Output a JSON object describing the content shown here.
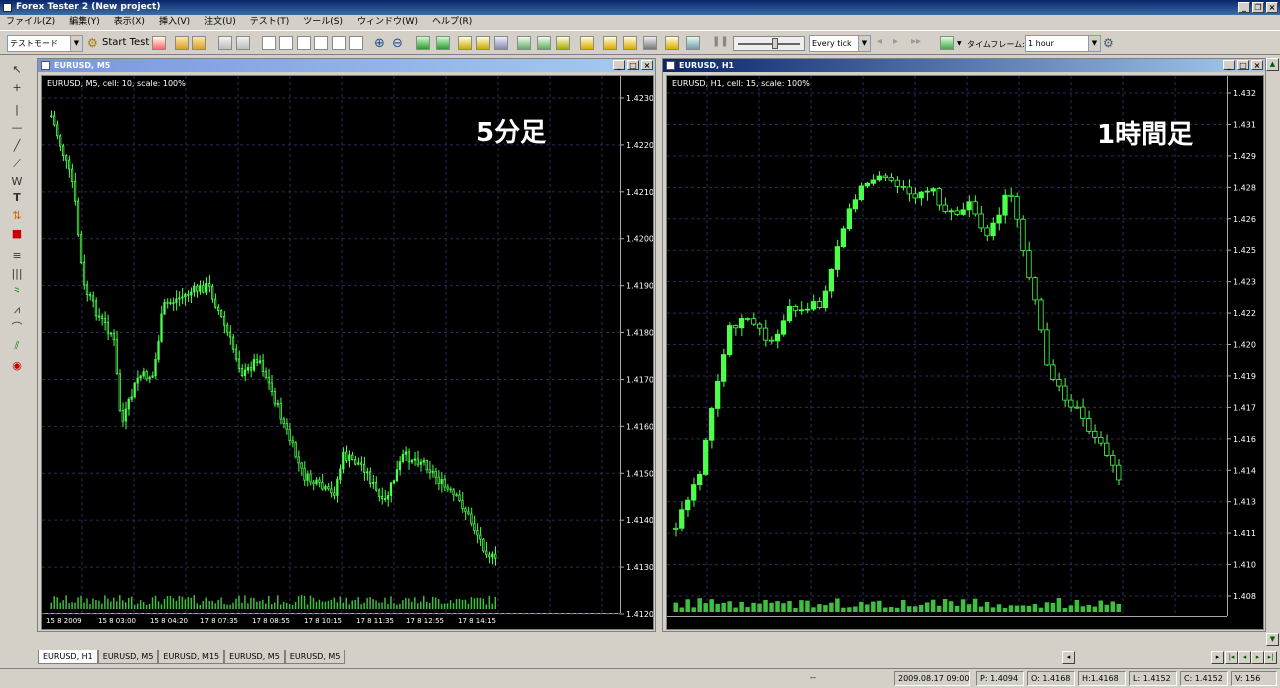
{
  "window": {
    "title": "Forex Tester 2  (New project)"
  },
  "menu": [
    "ファイル(Z)",
    "編集(Y)",
    "表示(X)",
    "挿入(V)",
    "注文(U)",
    "テスト(T)",
    "ツール(S)",
    "ウィンドウ(W)",
    "ヘルプ(R)"
  ],
  "toolbar": {
    "mode": "テストモード",
    "start_test": "Start Test",
    "tick_mode": "Every tick",
    "timeframe_label": "タイムフレーム:",
    "timeframe_value": "1 hour"
  },
  "charts": {
    "left": {
      "title": "EURUSD, M5",
      "info": "EURUSD, M5, cell: 10, scale: 100%",
      "annotation": "5分足",
      "price_labels": [
        "1.4230",
        "1.4220",
        "1.4210",
        "1.4200",
        "1.4190",
        "1.4180",
        "1.4170",
        "1.4160",
        "1.4150",
        "1.4140",
        "1.4130",
        "1.4120"
      ],
      "time_labels": [
        "15 8 2009",
        "15 8 03:00",
        "15 8 04:20",
        "17 8 07:35",
        "17 8 08:55",
        "17 8 10:15",
        "17 8 11:35",
        "17 8 12:55",
        "17 8 14:15"
      ]
    },
    "right": {
      "title": "EURUSD, H1",
      "info": "EURUSD, H1, cell: 15, scale: 100%",
      "annotation": "1時間足",
      "price_labels": [
        "1.432",
        "1.431",
        "1.429",
        "1.428",
        "1.426",
        "1.425",
        "1.423",
        "1.422",
        "1.420",
        "1.419",
        "1.417",
        "1.416",
        "1.414",
        "1.413",
        "1.411",
        "1.410",
        "1.408"
      ]
    }
  },
  "tabs": [
    "EURUSD, H1",
    "EURUSD, M5",
    "EURUSD, M15",
    "EURUSD, M5",
    "EURUSD, M5"
  ],
  "status": {
    "left": "--",
    "datetime": "2009.08.17 09:00",
    "price": "P: 1.4094",
    "open": "O: 1.4168",
    "high": "H:1.4168",
    "low": "L: 1.4152",
    "close": "C: 1.4152",
    "volume": "V: 156"
  },
  "colors": {
    "candle": "#4dff4d",
    "grid": "#2a2a5a",
    "background": "#000000"
  }
}
